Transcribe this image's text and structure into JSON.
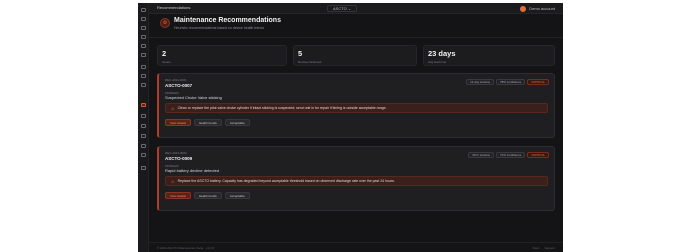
{
  "topbar": {
    "title": "Recommendations",
    "selector_label": "ASCTO",
    "selector_chevron": "⌄",
    "account_label": "Demo account"
  },
  "header": {
    "title": "Maintenance Recommendations",
    "subtitle": "Heuristic recommendations based on device health trends",
    "icon": "wrench-icon"
  },
  "stats": [
    {
      "value": "2",
      "label": "Issues"
    },
    {
      "value": "5",
      "label": "Devices Scanned"
    },
    {
      "value": "23 days",
      "label": "Avg lead time"
    }
  ],
  "cards": [
    {
      "meta": "REC-2024-0001",
      "device": "ASCTO-0007",
      "problem_label": "PROBLEM",
      "problem": "Suspected Choke Valve sticking",
      "badges": [
        "14 day window",
        "78% confidence",
        "CRITICAL"
      ],
      "action": "Clean or replace the pilot valve choke cylinder if intact sticking is suspected; send unit in for repair if timing is outside acceptable range.",
      "buttons": [
        "View details",
        "Health trends",
        "Acceptable"
      ]
    },
    {
      "meta": "REC-2024-0002",
      "device": "ASCTO-0009",
      "problem_label": "PROBLEM",
      "problem": "Rapid battery decline detected",
      "badges": [
        "30 hr window",
        "71% confidence",
        "CRITICAL"
      ],
      "action": "Replace the ASCTO battery. Capacity has degraded beyond acceptable threshold based on observed discharge rate over the past 24 hours.",
      "buttons": [
        "View details",
        "Health trends",
        "Acceptable"
      ]
    }
  ],
  "footer": {
    "copyright": "© 2024 ASCTO Maintenance Suite · v1.0.0",
    "links": [
      "Docs",
      "Support"
    ]
  },
  "colors": {
    "accent": "#d9563a",
    "critical": "#ec6a52",
    "background": "#141416"
  }
}
